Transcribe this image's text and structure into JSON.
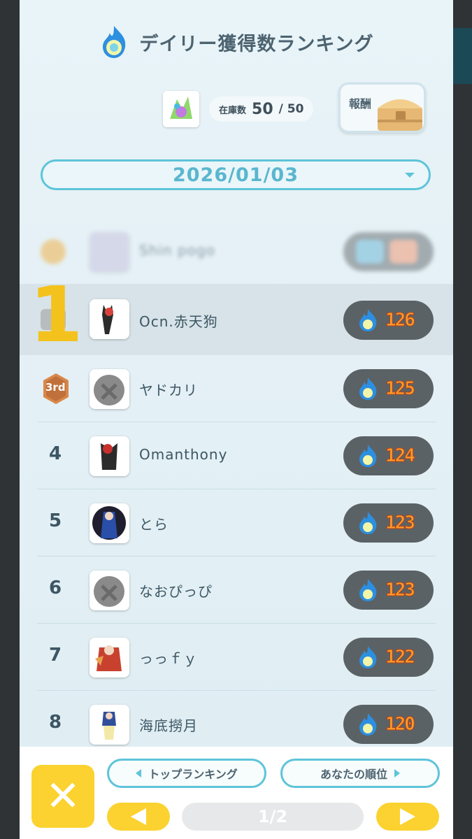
{
  "header": {
    "title": "デイリー獲得数ランキング",
    "icon": "blue-flame-icon"
  },
  "stock": {
    "label": "在庫数",
    "value": "50",
    "max": "/ 50"
  },
  "reward": {
    "label": "報酬",
    "icon": "treasure-chest-icon"
  },
  "date_select": {
    "value": "2026/01/03"
  },
  "rows": [
    {
      "rank": "",
      "name": "Shin pogo",
      "score": "",
      "style": "blurred"
    },
    {
      "rank": "",
      "name": "Ocn.赤天狗",
      "score": "126",
      "style": "highlighted"
    },
    {
      "rank": "3rd",
      "name": "ヤドカリ",
      "score": "125",
      "style": "bronze"
    },
    {
      "rank": "4",
      "name": "Omanthony",
      "score": "124"
    },
    {
      "rank": "5",
      "name": "とら",
      "score": "123"
    },
    {
      "rank": "6",
      "name": "なおぴっぴ",
      "score": "123"
    },
    {
      "rank": "7",
      "name": "っっｆｙ",
      "score": "122"
    },
    {
      "rank": "8",
      "name": "海底撈月",
      "score": "120"
    }
  ],
  "overlay_number": "1",
  "bottom": {
    "top_ranking_label": "トップランキング",
    "your_rank_label": "あなたの順位",
    "page": "1/2"
  },
  "colors": {
    "accent_teal": "#5ec4d9",
    "yellow": "#fbd22f",
    "score_orange": "#ff9d28"
  }
}
